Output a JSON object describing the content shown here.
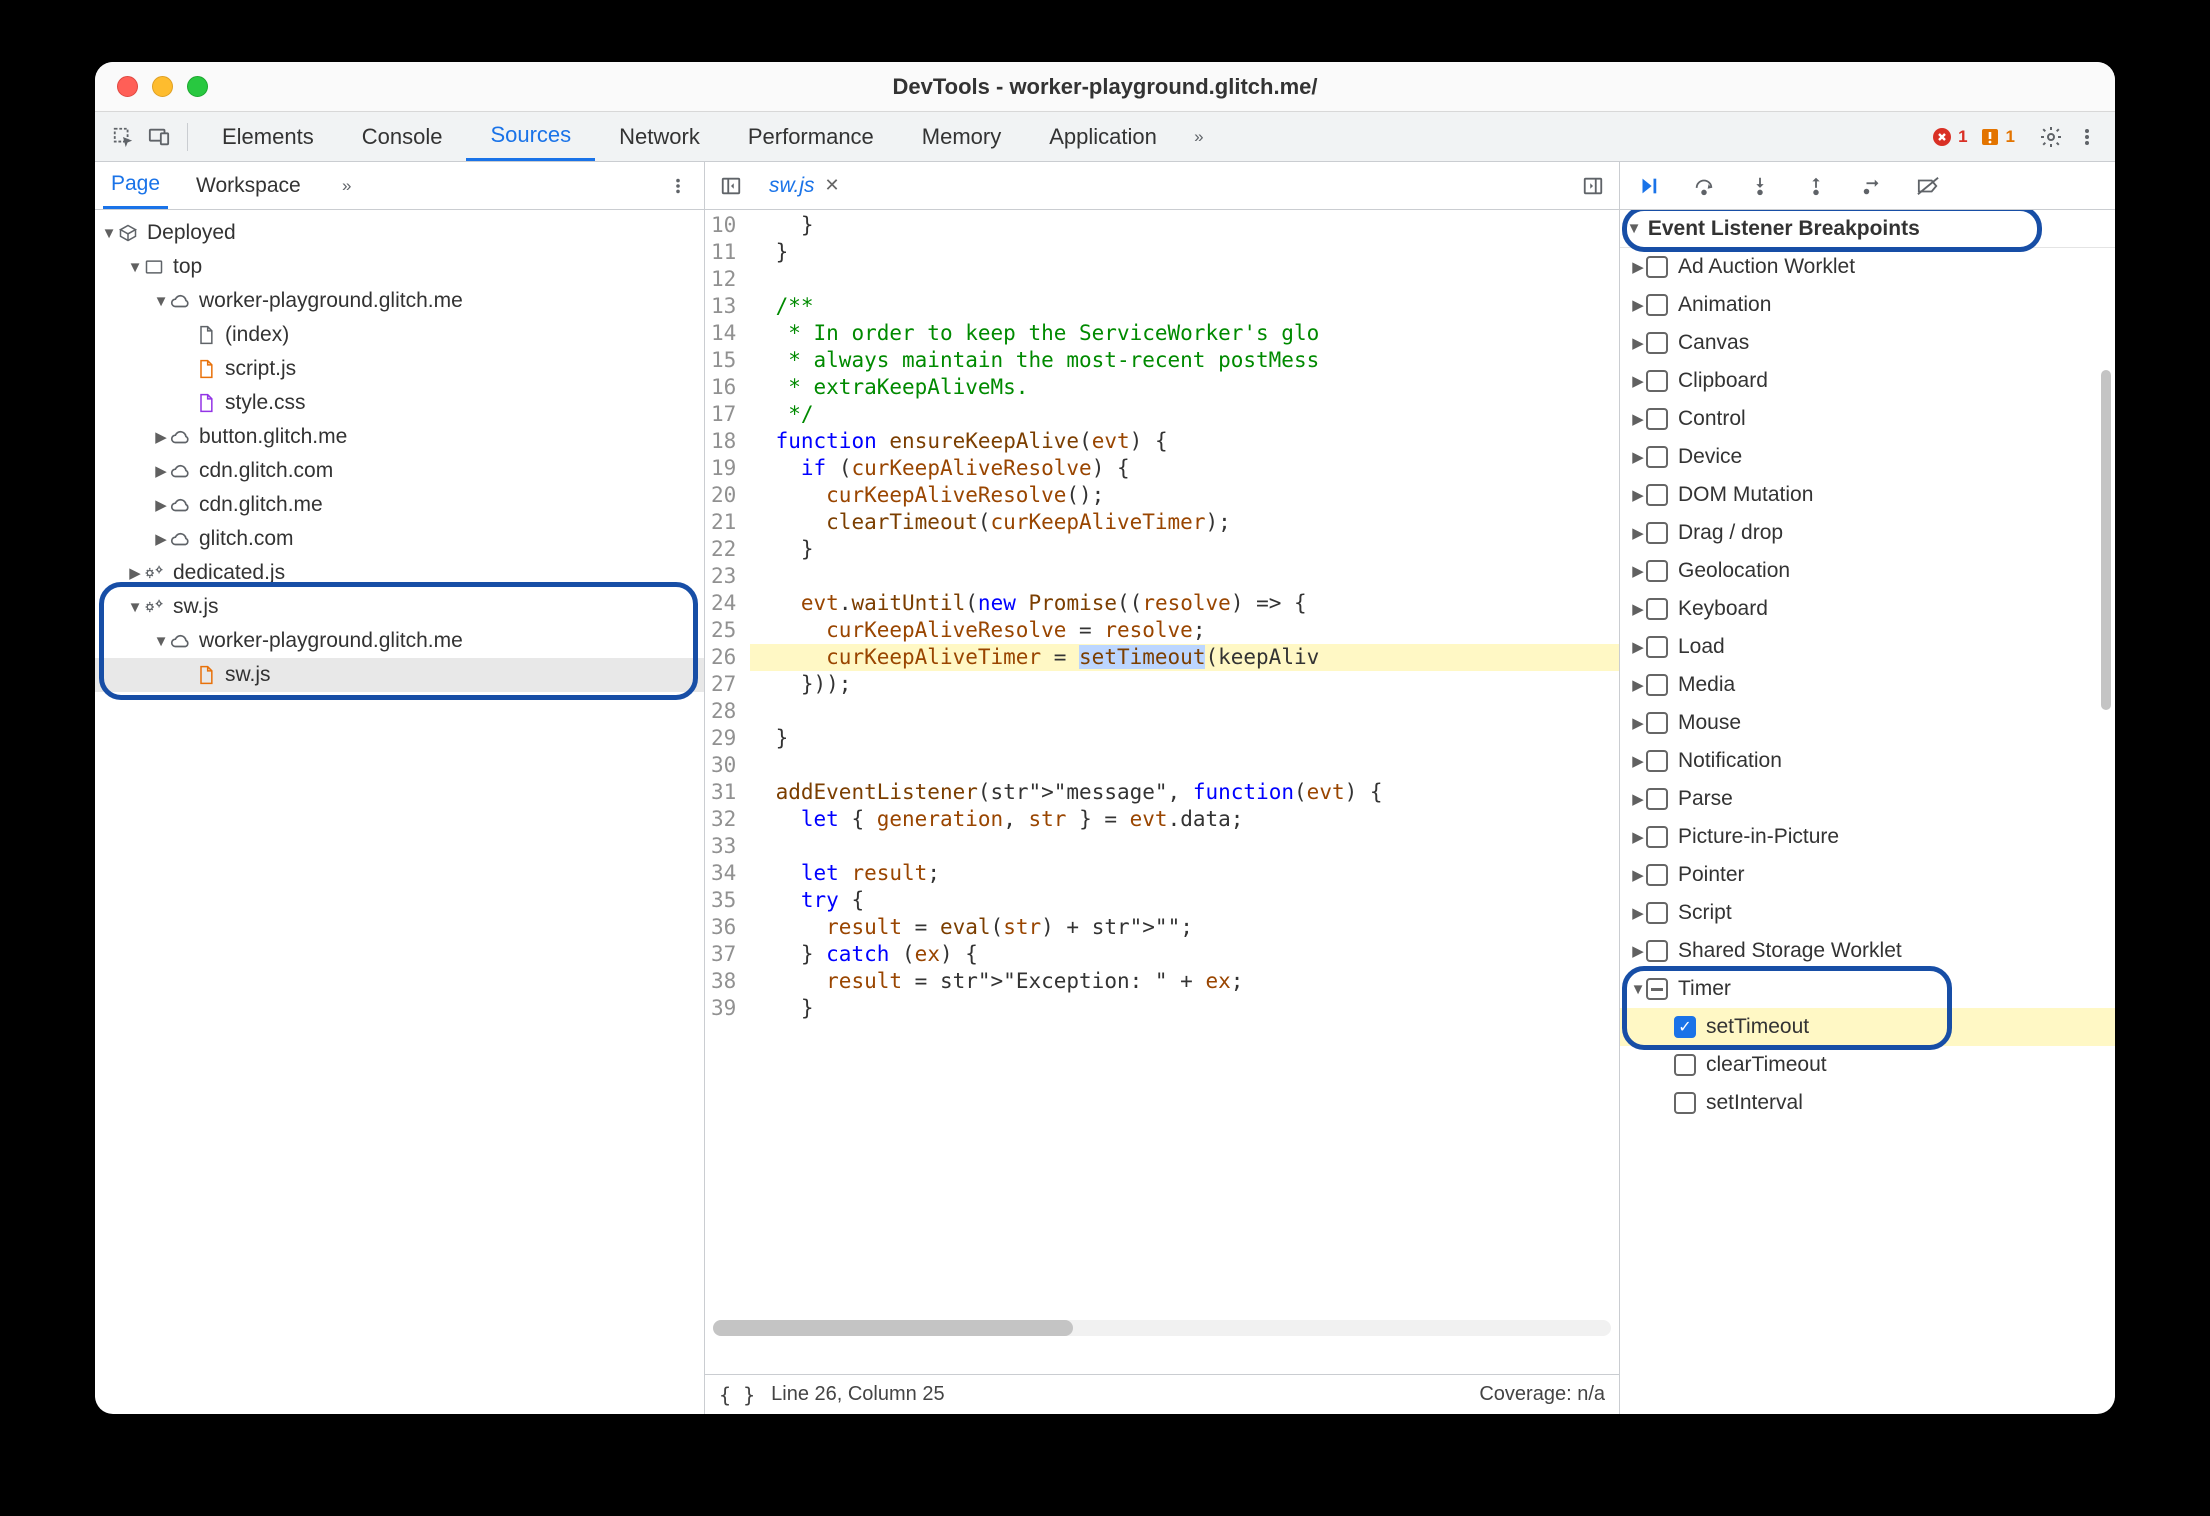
{
  "window": {
    "title": "DevTools - worker-playground.glitch.me/"
  },
  "tabs": {
    "items": [
      "Elements",
      "Console",
      "Sources",
      "Network",
      "Performance",
      "Memory",
      "Application"
    ],
    "active": "Sources",
    "more": "»",
    "error_count": "1",
    "warn_count": "1"
  },
  "left": {
    "subtabs": {
      "items": [
        "Page",
        "Workspace"
      ],
      "active": "Page",
      "more": "»"
    },
    "tree": [
      {
        "depth": 0,
        "disc": "▼",
        "icon": "cube",
        "label": "Deployed"
      },
      {
        "depth": 1,
        "disc": "▼",
        "icon": "frame",
        "label": "top"
      },
      {
        "depth": 2,
        "disc": "▼",
        "icon": "cloud",
        "label": "worker-playground.glitch.me"
      },
      {
        "depth": 3,
        "disc": "",
        "icon": "file",
        "label": "(index)"
      },
      {
        "depth": 3,
        "disc": "",
        "icon": "file-js",
        "label": "script.js"
      },
      {
        "depth": 3,
        "disc": "",
        "icon": "file-css",
        "label": "style.css"
      },
      {
        "depth": 2,
        "disc": "▶",
        "icon": "cloud",
        "label": "button.glitch.me"
      },
      {
        "depth": 2,
        "disc": "▶",
        "icon": "cloud",
        "label": "cdn.glitch.com"
      },
      {
        "depth": 2,
        "disc": "▶",
        "icon": "cloud",
        "label": "cdn.glitch.me"
      },
      {
        "depth": 2,
        "disc": "▶",
        "icon": "cloud",
        "label": "glitch.com"
      },
      {
        "depth": 1,
        "disc": "▶",
        "icon": "gears",
        "label": "dedicated.js"
      },
      {
        "depth": 1,
        "disc": "▼",
        "icon": "gears",
        "label": "sw.js"
      },
      {
        "depth": 2,
        "disc": "▼",
        "icon": "cloud",
        "label": "worker-playground.glitch.me"
      },
      {
        "depth": 3,
        "disc": "",
        "icon": "file-js",
        "label": "sw.js",
        "selected": true
      }
    ]
  },
  "editor": {
    "tab": {
      "name": "sw.js"
    },
    "first_line": 10,
    "lines": [
      "    }",
      "  }",
      "",
      "  /**",
      "   * In order to keep the ServiceWorker's glo",
      "   * always maintain the most-recent postMess",
      "   * extraKeepAliveMs.",
      "   */",
      "  function ensureKeepAlive(evt) {",
      "    if (curKeepAliveResolve) {",
      "      curKeepAliveResolve();",
      "      clearTimeout(curKeepAliveTimer);",
      "    }",
      "",
      "    evt.waitUntil(new Promise((resolve) => {",
      "      curKeepAliveResolve = resolve;",
      "      curKeepAliveTimer = setTimeout(keepAliv",
      "    }));",
      "",
      "  }",
      "",
      "  addEventListener(\"message\", function(evt) {",
      "    let { generation, str } = evt.data;",
      "",
      "    let result;",
      "    try {",
      "      result = eval(str) + \"\";",
      "    } catch (ex) {",
      "      result = \"Exception: \" + ex;",
      "    }"
    ],
    "highlight_line": 26,
    "status": {
      "pos": "Line 26, Column 25",
      "coverage": "Coverage: n/a"
    }
  },
  "right": {
    "section": "Event Listener Breakpoints",
    "categories": [
      {
        "label": "Ad Auction Worklet",
        "state": "off",
        "expanded": false
      },
      {
        "label": "Animation",
        "state": "off",
        "expanded": false
      },
      {
        "label": "Canvas",
        "state": "off",
        "expanded": false
      },
      {
        "label": "Clipboard",
        "state": "off",
        "expanded": false
      },
      {
        "label": "Control",
        "state": "off",
        "expanded": false
      },
      {
        "label": "Device",
        "state": "off",
        "expanded": false
      },
      {
        "label": "DOM Mutation",
        "state": "off",
        "expanded": false
      },
      {
        "label": "Drag / drop",
        "state": "off",
        "expanded": false
      },
      {
        "label": "Geolocation",
        "state": "off",
        "expanded": false
      },
      {
        "label": "Keyboard",
        "state": "off",
        "expanded": false
      },
      {
        "label": "Load",
        "state": "off",
        "expanded": false
      },
      {
        "label": "Media",
        "state": "off",
        "expanded": false
      },
      {
        "label": "Mouse",
        "state": "off",
        "expanded": false
      },
      {
        "label": "Notification",
        "state": "off",
        "expanded": false
      },
      {
        "label": "Parse",
        "state": "off",
        "expanded": false
      },
      {
        "label": "Picture-in-Picture",
        "state": "off",
        "expanded": false
      },
      {
        "label": "Pointer",
        "state": "off",
        "expanded": false
      },
      {
        "label": "Script",
        "state": "off",
        "expanded": false
      },
      {
        "label": "Shared Storage Worklet",
        "state": "off",
        "expanded": false
      },
      {
        "label": "Timer",
        "state": "mixed",
        "expanded": true,
        "children": [
          {
            "label": "setTimeout",
            "checked": true,
            "hl": true
          },
          {
            "label": "clearTimeout",
            "checked": false
          },
          {
            "label": "setInterval",
            "checked": false
          }
        ]
      }
    ]
  }
}
